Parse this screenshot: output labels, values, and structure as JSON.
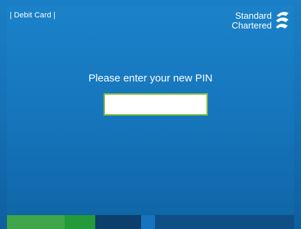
{
  "header": {
    "card_type": "| Debit Card |"
  },
  "brand": {
    "line1": "Standard",
    "line2": "Chartered",
    "logo_icon": "standard-chartered-logo-icon"
  },
  "main": {
    "prompt": "Please enter your new PIN",
    "pin_value": "",
    "pin_placeholder": ""
  },
  "colors": {
    "background_blue": "#1676bd",
    "accent_green": "#7fbf3a",
    "stripe_light_green": "#3ea54a",
    "stripe_green": "#249a3a",
    "stripe_navy": "#0c3f6c",
    "stripe_blue": "#1673c0",
    "stripe_dark_blue": "#0f4f86"
  }
}
